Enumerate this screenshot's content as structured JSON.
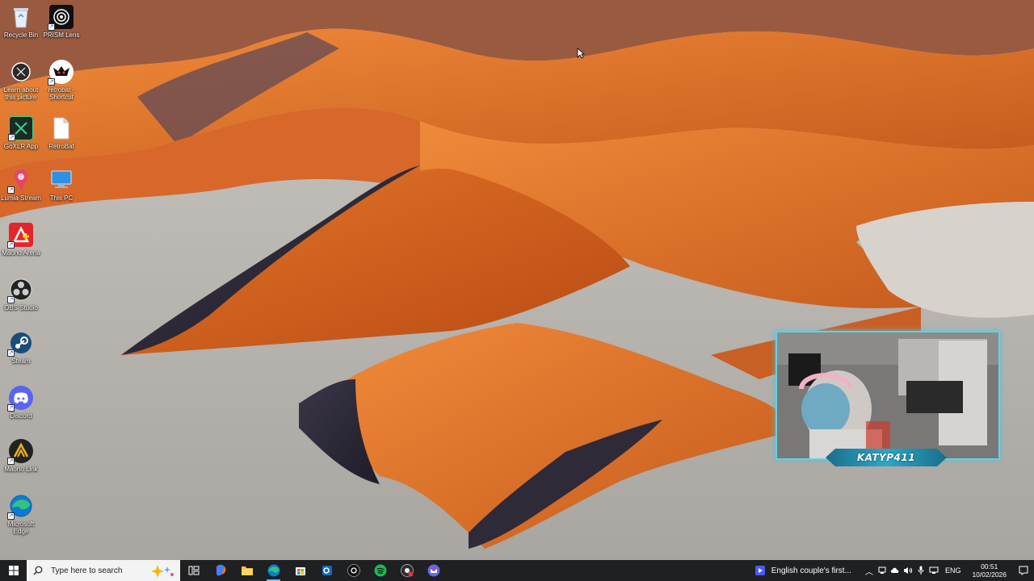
{
  "desktop": {
    "icons": [
      {
        "label": "Recycle Bin",
        "icon": "recycle-bin-icon"
      },
      {
        "label": "PRISM Lens",
        "icon": "prism-lens-icon"
      },
      {
        "label": "Learn about this picture",
        "icon": "learn-about-picture-icon"
      },
      {
        "label": "retrobat - Shortcut",
        "icon": "retrobat-shortcut-icon"
      },
      {
        "label": "GoXLR App",
        "icon": "goxlr-icon"
      },
      {
        "label": "RetroBat",
        "icon": "file-icon"
      },
      {
        "label": "Lumia Stream",
        "icon": "lumia-stream-icon"
      },
      {
        "label": "This PC",
        "icon": "this-pc-icon"
      },
      {
        "label": "Maono Arena",
        "icon": "maono-arena-icon"
      },
      {
        "label": "OBS Studio",
        "icon": "obs-studio-icon"
      },
      {
        "label": "Steam",
        "icon": "steam-icon"
      },
      {
        "label": "Discord",
        "icon": "discord-icon"
      },
      {
        "label": "Maono Link",
        "icon": "maono-link-icon"
      },
      {
        "label": "Microsoft Edge",
        "icon": "edge-icon"
      }
    ]
  },
  "webcam": {
    "streamer_name": "KATYP411"
  },
  "taskbar": {
    "search_placeholder": "Type here to search",
    "pinned": [
      "start-icon",
      "task-view-icon",
      "copilot-icon",
      "file-explorer-icon",
      "edge-icon",
      "store-icon",
      "outlook-icon",
      "obs-icon",
      "spotify-icon",
      "chrome-icon",
      "gmail-icon"
    ],
    "media_title": "English couple's first...",
    "language": "ENG",
    "time": "00:51",
    "date": "10/02/2026"
  },
  "colors": {
    "taskbar_bg": "#1f2022",
    "accent": "#79b8f5",
    "cam_border": "#5fd3e6"
  }
}
